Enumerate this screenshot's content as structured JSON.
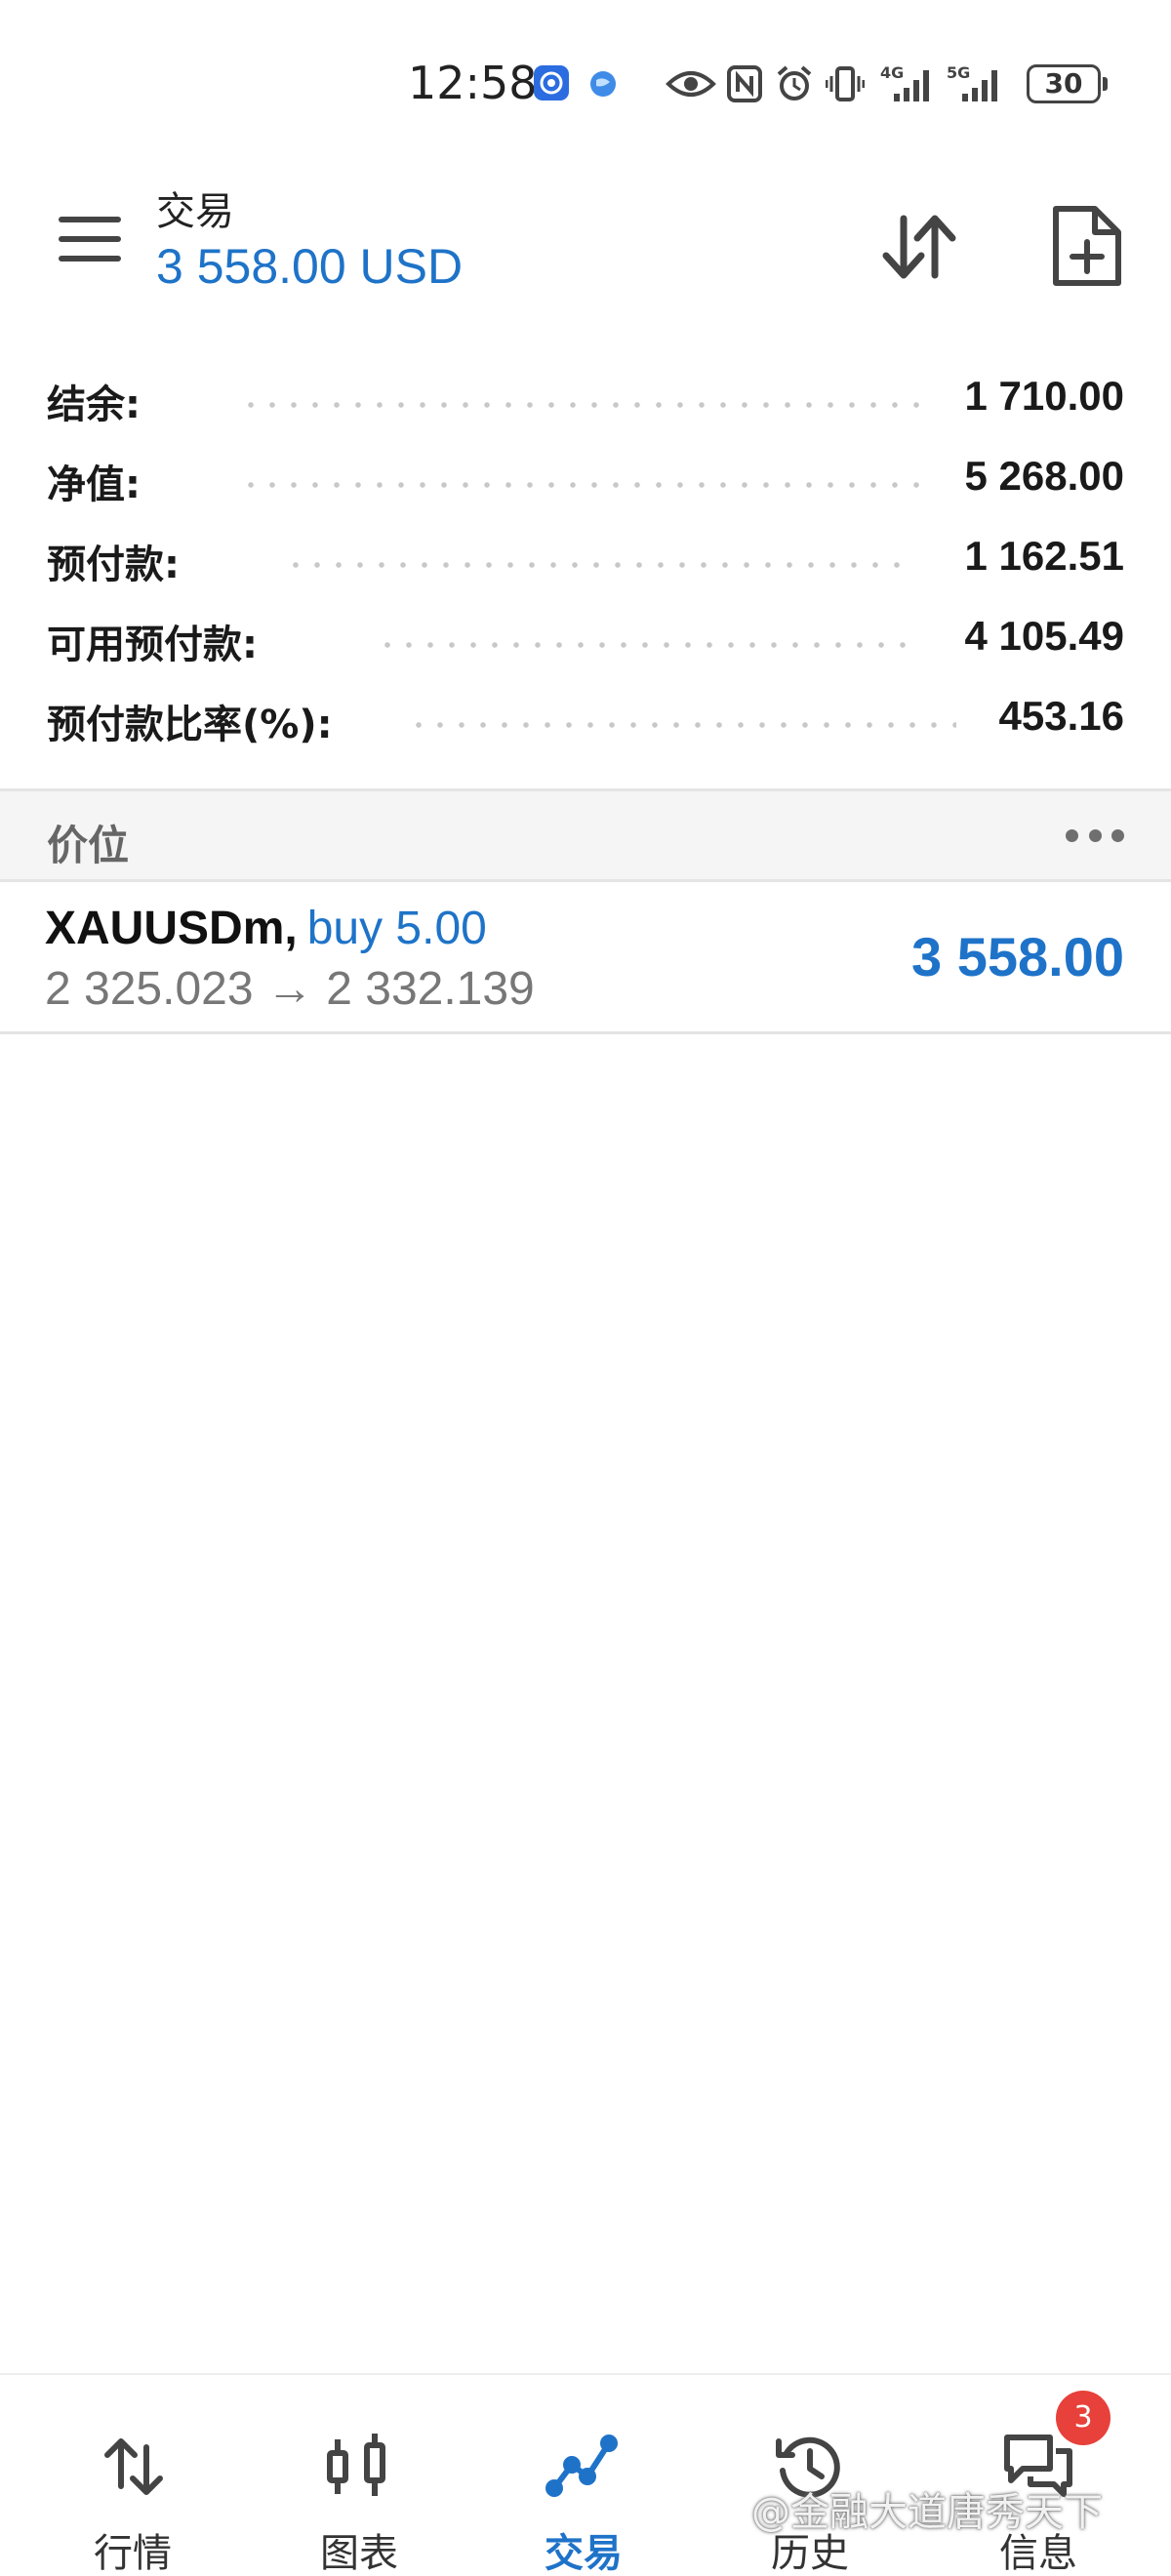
{
  "status_bar": {
    "time": "12:58",
    "network_1": "4G",
    "network_2": "5G",
    "battery": "30"
  },
  "header": {
    "title": "交易",
    "balance": "3 558.00 USD"
  },
  "account": [
    {
      "label": "结余:",
      "value": "1 710.00"
    },
    {
      "label": "净值:",
      "value": "5 268.00"
    },
    {
      "label": "预付款:",
      "value": "1 162.51"
    },
    {
      "label": "可用预付款:",
      "value": "4 105.49"
    },
    {
      "label": "预付款比率(%):",
      "value": "453.16"
    }
  ],
  "section": {
    "title": "价位"
  },
  "position": {
    "symbol": "XAUUSDm,",
    "type": "buy 5.00",
    "prices": "2 325.023 → 2 332.139",
    "profit": "3 558.00"
  },
  "nav": {
    "items": [
      {
        "label": "行情",
        "icon": "quotes-arrows-icon"
      },
      {
        "label": "图表",
        "icon": "candlestick-chart-icon"
      },
      {
        "label": "交易",
        "icon": "trade-line-icon"
      },
      {
        "label": "历史",
        "icon": "history-clock-icon"
      },
      {
        "label": "信息",
        "icon": "messages-chat-icon"
      }
    ],
    "messages_badge": "3"
  },
  "watermark": "@金融大道唐秀天下",
  "colors": {
    "accent": "#1e73c8",
    "badge": "#e8403a"
  }
}
